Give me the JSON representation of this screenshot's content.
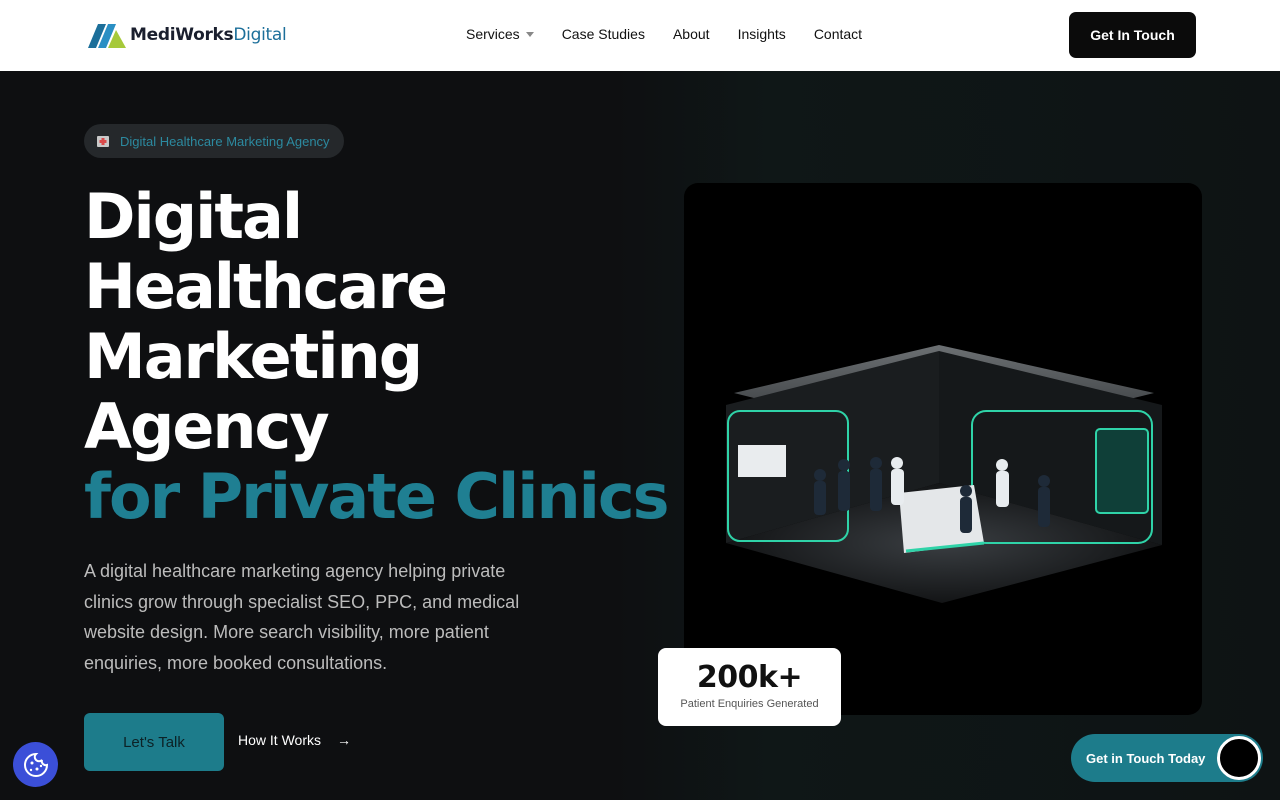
{
  "header": {
    "logo": {
      "text_a": "MediWorks",
      "text_b": "Digital"
    },
    "nav": [
      {
        "label": "Services",
        "has_dropdown": true
      },
      {
        "label": "Case Studies"
      },
      {
        "label": "About"
      },
      {
        "label": "Insights"
      },
      {
        "label": "Contact"
      }
    ],
    "cta_label": "Get In Touch"
  },
  "hero": {
    "badge": "Digital Healthcare Marketing Agency",
    "headline_lines": [
      "Digital",
      "Healthcare",
      "Marketing",
      "Agency"
    ],
    "headline_accent": "for Private Clinics",
    "description": "A digital healthcare marketing agency helping private clinics grow through specialist SEO, PPC, and medical website design. More search visibility, more patient enquiries, more booked consultations.",
    "primary_button": "Let's Talk",
    "secondary_button": "How It Works"
  },
  "stat": {
    "value": "200k+",
    "label": "Patient Enquiries Generated"
  },
  "floating_cta": "Get in Touch Today",
  "colors": {
    "accent": "#1d7c8b",
    "cookie_button": "#3b4fd8",
    "headline_accent": "#1f7f92"
  },
  "icons": [
    "hospital-icon",
    "arrow-right-icon",
    "cookie-icon",
    "chevron-down-icon"
  ]
}
